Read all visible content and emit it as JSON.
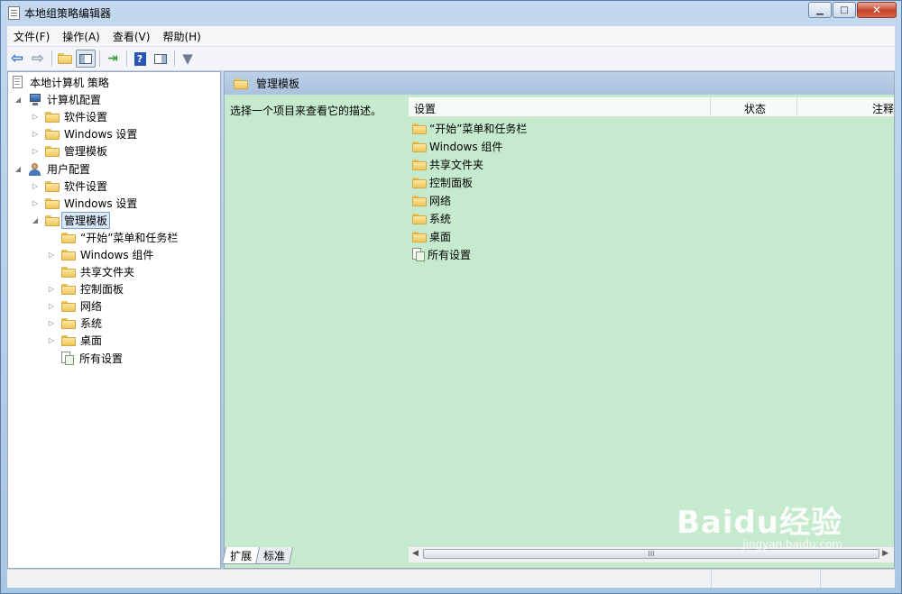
{
  "window": {
    "title": "本地组策略编辑器"
  },
  "menu": [
    "文件(F)",
    "操作(A)",
    "查看(V)",
    "帮助(H)"
  ],
  "toolbar": {
    "icons": [
      "back-arrow-icon",
      "forward-arrow-icon",
      "up-folder-icon",
      "show-hide-tree-icon",
      "export-list-icon",
      "help-icon",
      "action-pane-icon",
      "filter-icon"
    ]
  },
  "tree": {
    "root": "本地计算机 策略",
    "computer_config": "计算机配置",
    "computer_children": [
      "软件设置",
      "Windows 设置",
      "管理模板"
    ],
    "user_config": "用户配置",
    "user_children": [
      "软件设置",
      "Windows 设置"
    ],
    "user_admin_templates": "管理模板",
    "admin_children": [
      "“开始”菜单和任务栏",
      "Windows 组件",
      "共享文件夹",
      "控制面板",
      "网络",
      "系统",
      "桌面"
    ],
    "all_settings": "所有设置"
  },
  "right_panel": {
    "header": "管理模板",
    "description": "选择一个项目来查看它的描述。",
    "columns": [
      "设置",
      "状态",
      "注释"
    ],
    "items": [
      "“开始”菜单和任务栏",
      "Windows 组件",
      "共享文件夹",
      "控制面板",
      "网络",
      "系统",
      "桌面",
      "所有设置"
    ]
  },
  "tabs": [
    "扩展",
    "标准"
  ],
  "scroll_thumb": "III",
  "watermark": {
    "brand": "Baidu经验",
    "url": "jingyan.baidu.com"
  }
}
